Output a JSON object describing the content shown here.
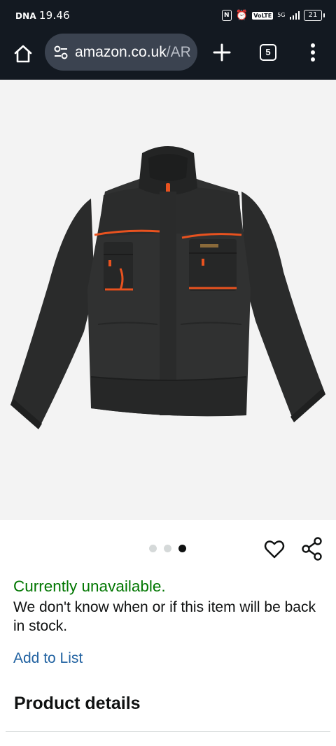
{
  "status_bar": {
    "carrier": "DNA",
    "time": "19.46",
    "volte_label": "VoLTE",
    "network_label": "5G",
    "battery": "21"
  },
  "browser": {
    "url_host": "amazon.co.uk",
    "url_path": "/AR",
    "tab_count": "5"
  },
  "product": {
    "image_index": "3 of 3",
    "availability": "Currently unavailable.",
    "stock_note": "We don't know when or if this item will be back in stock.",
    "add_to_list": "Add to List",
    "details_heading": "Product details"
  },
  "colors": {
    "toolbar_bg": "#131921",
    "availability_green": "#007600",
    "link_blue": "#2162a1",
    "jacket_trim": "#e8521f"
  }
}
